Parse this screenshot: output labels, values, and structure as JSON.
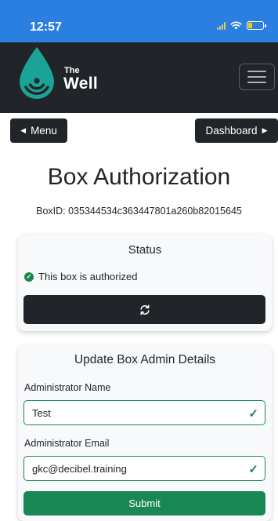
{
  "status_bar": {
    "time": "12:57",
    "icons": [
      "cellular-signal-icon",
      "wifi-icon",
      "battery-low-icon"
    ]
  },
  "navbar": {
    "brand_small": "The",
    "brand_large": "Well",
    "logo_icon": "water-drop-wifi-icon",
    "toggle_icon": "hamburger-menu-icon"
  },
  "nav_buttons": {
    "menu_label": "Menu",
    "dashboard_label": "Dashboard"
  },
  "page": {
    "title": "Box Authorization",
    "box_id": "BoxID: 035344534c363447801a260b82015645"
  },
  "status_card": {
    "title": "Status",
    "authorized_text": "This box is authorized",
    "refresh_icon": "refresh-icon"
  },
  "update_card": {
    "title": "Update Box Admin Details",
    "name_label": "Administrator Name",
    "name_value": "Test",
    "email_label": "Administrator Email",
    "email_value": "gkc@decibel.training",
    "submit_label": "Submit"
  },
  "colors": {
    "status_bar": "#2b7fe0",
    "navbar": "#212529",
    "logo": "#1aa396",
    "success": "#198754"
  }
}
